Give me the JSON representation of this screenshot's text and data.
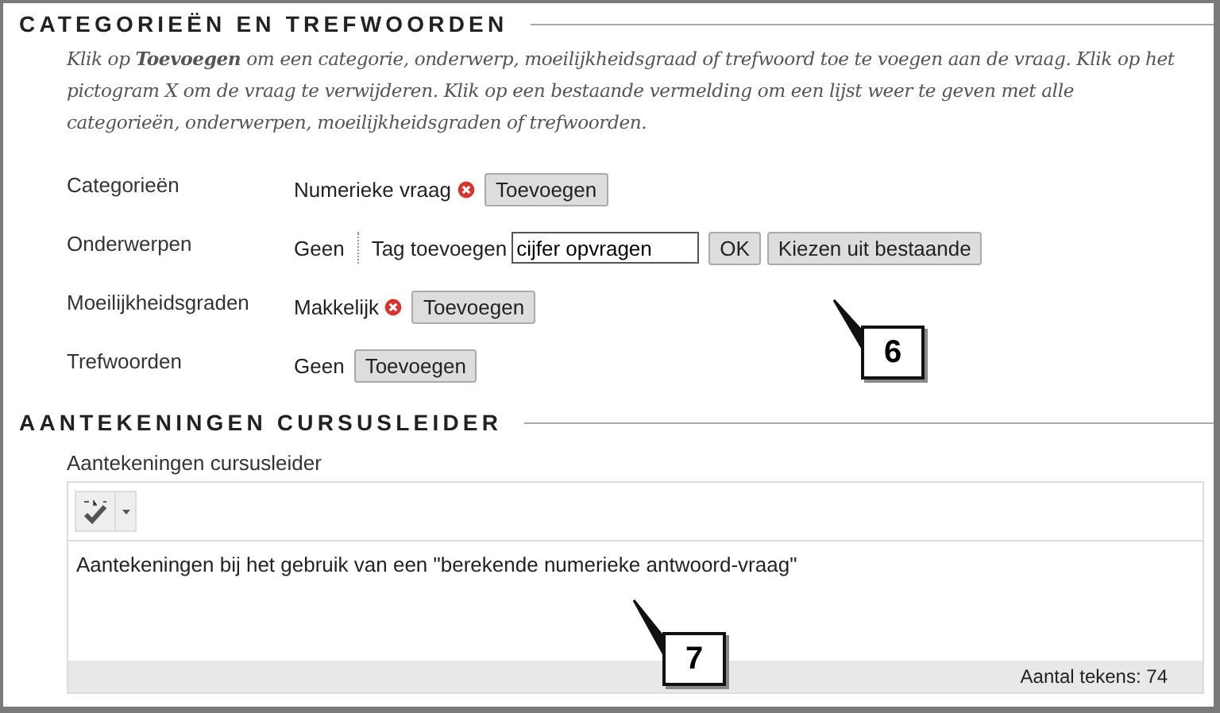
{
  "categories_section": {
    "heading": "CATEGORIEËN EN TREFWOORDEN",
    "instructions": "Klik op **Toevoegen** om een categorie, onderwerp, moeilijkheidsgraad of trefwoord toe te voegen aan de vraag. Klik op het pictogram X om de vraag te verwijderen. Klik op een bestaande vermelding om een lijst weer te geven met alle categorieën, onderwerpen, moeilijkheidsgraden of trefwoorden.",
    "rows": [
      {
        "label": "Categorieën",
        "kind": "tags",
        "items": [
          {
            "text": "Numerieke vraag",
            "removable": true
          }
        ],
        "add_button": "Toevoegen"
      },
      {
        "label": "Onderwerpen",
        "kind": "tag_input",
        "items": [
          {
            "text": "Geen",
            "removable": false
          }
        ],
        "input_label": "Tag toevoegen",
        "input_value": "cijfer opvragen",
        "ok_button": "OK",
        "choose_button": "Kiezen uit bestaande"
      },
      {
        "label": "Moeilijkheidsgraden",
        "kind": "tags",
        "items": [
          {
            "text": "Makkelijk",
            "removable": true
          }
        ],
        "add_button": "Toevoegen"
      },
      {
        "label": "Trefwoorden",
        "kind": "tags",
        "items": [
          {
            "text": "Geen",
            "removable": false
          }
        ],
        "add_button": "Toevoegen"
      }
    ]
  },
  "notes_section": {
    "heading": "AANTEKENINGEN CURSUSLEIDER",
    "field_label": "Aantekeningen cursusleider",
    "editor_text": "Aantekeningen bij het gebruik van een \"berekende numerieke antwoord-vraag\"",
    "char_count": "Aantal tekens: 74"
  },
  "callouts": [
    {
      "label": "6"
    },
    {
      "label": "7"
    }
  ]
}
